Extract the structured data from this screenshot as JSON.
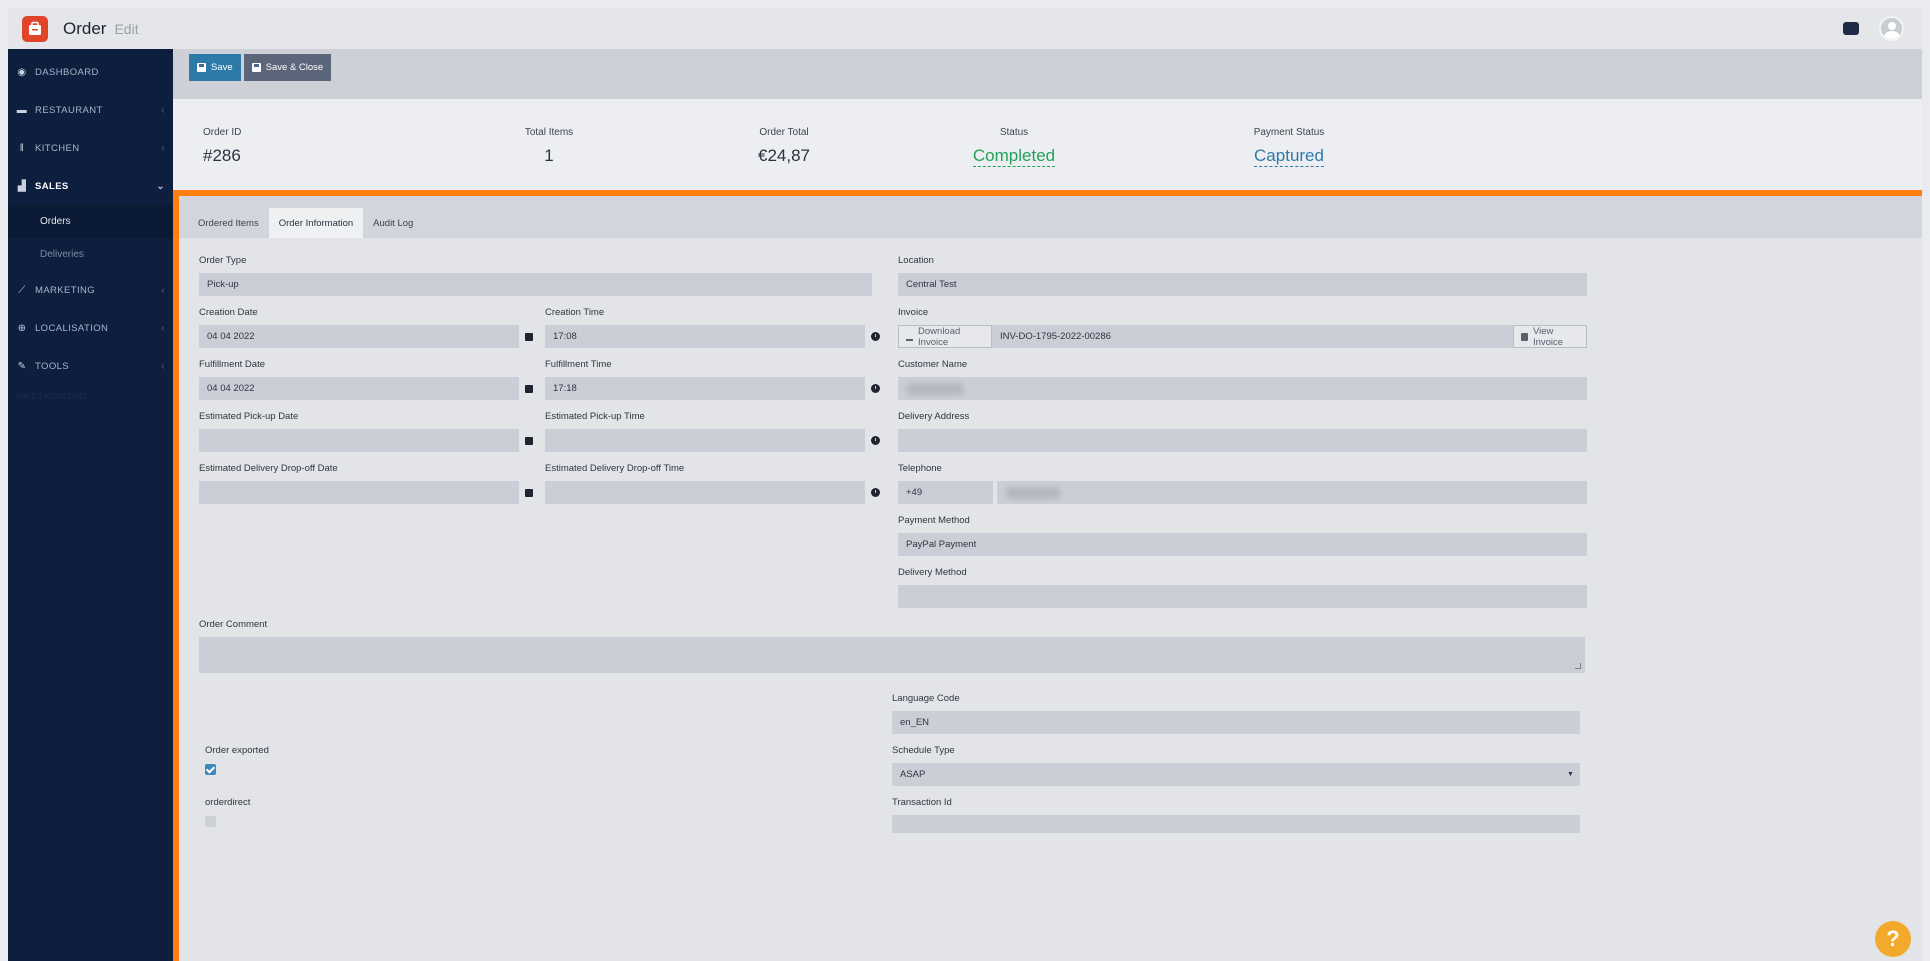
{
  "app": {
    "title": "Order",
    "subtitle": "Edit"
  },
  "colors": {
    "accent": "#2d7aa8",
    "sidebar": "#0d1e3e",
    "highlight": "#ff7f0e",
    "status_green": "#22a35a",
    "help": "#f3a92c"
  },
  "sidebar": {
    "items": [
      {
        "label": "DASHBOARD",
        "icon": "dashboard-icon"
      },
      {
        "label": "RESTAURANT",
        "icon": "store-icon"
      },
      {
        "label": "KITCHEN",
        "icon": "cutlery-icon"
      },
      {
        "label": "SALES",
        "icon": "chart-icon"
      },
      {
        "label": "MARKETING",
        "icon": "chart-line-icon"
      },
      {
        "label": "LOCALISATION",
        "icon": "globe-icon"
      },
      {
        "label": "TOOLS",
        "icon": "wrench-icon"
      }
    ],
    "sub_items": [
      {
        "label": "Orders"
      },
      {
        "label": "Deliveries"
      }
    ],
    "ghost_text": "SALES ASSISTANT"
  },
  "toolbar": {
    "save_label": "Save",
    "save_close_label": "Save & Close"
  },
  "summary": {
    "order_id": {
      "label": "Order ID",
      "value": "#286"
    },
    "total_items": {
      "label": "Total Items",
      "value": "1"
    },
    "order_total": {
      "label": "Order Total",
      "value": "€24,87"
    },
    "status": {
      "label": "Status",
      "value": "Completed"
    },
    "payment_status": {
      "label": "Payment Status",
      "value": "Captured"
    }
  },
  "tabs": [
    {
      "label": "Ordered Items"
    },
    {
      "label": "Order Information"
    },
    {
      "label": "Audit Log"
    }
  ],
  "form": {
    "order_type": {
      "label": "Order Type",
      "value": "Pick-up"
    },
    "location": {
      "label": "Location",
      "value": "Central Test"
    },
    "creation_date": {
      "label": "Creation Date",
      "value": "04 04 2022"
    },
    "creation_time": {
      "label": "Creation Time",
      "value": "17:08"
    },
    "invoice": {
      "label": "Invoice",
      "download_label": "Download Invoice",
      "value": "INV-DO-1795-2022-00286",
      "view_label": "View Invoice"
    },
    "fulfillment_date": {
      "label": "Fulfillment Date",
      "value": "04 04 2022"
    },
    "fulfillment_time": {
      "label": "Fulfillment Time",
      "value": "17:18"
    },
    "customer_name": {
      "label": "Customer Name"
    },
    "est_pickup_date": {
      "label": "Estimated Pick-up Date",
      "value": ""
    },
    "est_pickup_time": {
      "label": "Estimated Pick-up Time",
      "value": ""
    },
    "delivery_address": {
      "label": "Delivery Address",
      "value": ""
    },
    "est_dropoff_date": {
      "label": "Estimated Delivery Drop-off Date",
      "value": ""
    },
    "est_dropoff_time": {
      "label": "Estimated Delivery Drop-off Time",
      "value": ""
    },
    "telephone": {
      "label": "Telephone",
      "prefix": "+49"
    },
    "payment_method": {
      "label": "Payment Method",
      "value": "PayPal Payment"
    },
    "delivery_method": {
      "label": "Delivery Method",
      "value": ""
    },
    "order_comment": {
      "label": "Order Comment",
      "value": ""
    },
    "language_code": {
      "label": "Language Code",
      "value": "en_EN"
    },
    "order_exported": {
      "label": "Order exported",
      "checked": true
    },
    "schedule_type": {
      "label": "Schedule Type",
      "value": "ASAP"
    },
    "orderdirect": {
      "label": "orderdirect",
      "checked": false
    },
    "transaction_id": {
      "label": "Transaction Id",
      "value": ""
    }
  },
  "help": {
    "label": "?"
  }
}
